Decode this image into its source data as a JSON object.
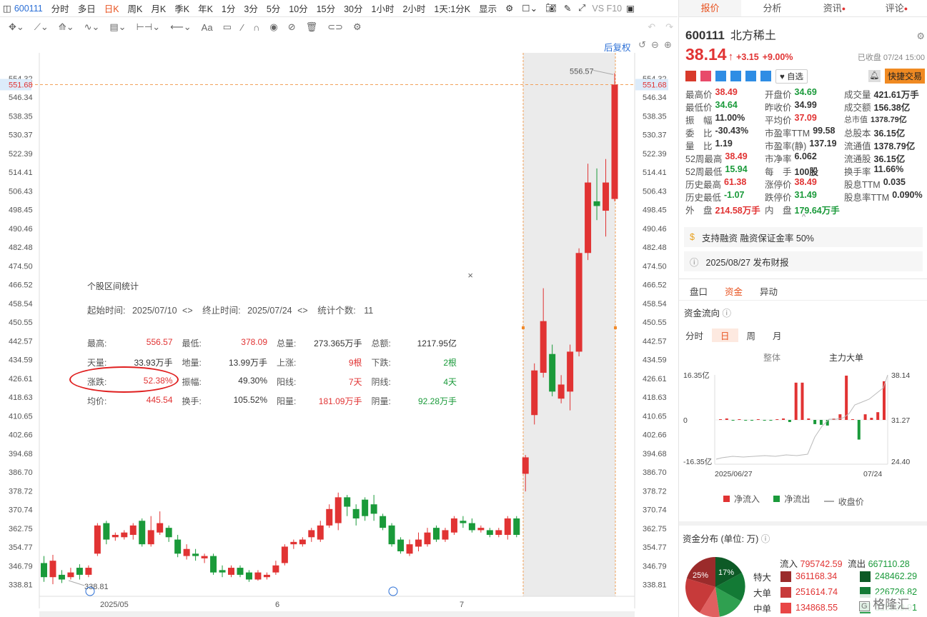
{
  "toolbar": {
    "code": "600111",
    "periods": [
      "分时",
      "多日",
      "日K",
      "周K",
      "月K",
      "季K",
      "年K",
      "1分",
      "3分",
      "5分",
      "10分",
      "15分",
      "30分",
      "1小时",
      "2小时",
      "1天:1分K",
      "显示"
    ],
    "active_period": "日K",
    "vs_label": "VS F10"
  },
  "chart": {
    "fuquan_label": "后复权",
    "y_ticks": [
      "554.32",
      "546.34",
      "538.35",
      "530.37",
      "522.39",
      "514.41",
      "506.43",
      "498.45",
      "490.46",
      "482.48",
      "474.50",
      "466.52",
      "458.54",
      "450.55",
      "442.57",
      "434.59",
      "426.61",
      "418.63",
      "410.65",
      "402.66",
      "394.68",
      "386.70",
      "378.72",
      "370.74",
      "362.75",
      "354.77",
      "346.79",
      "338.81"
    ],
    "x_labels": [
      "2025/05",
      "6",
      "7"
    ],
    "current_price_label": "551.68",
    "high_label": "556.57",
    "low_label": "338.81"
  },
  "chart_data": {
    "type": "candlestick",
    "ylim": [
      334,
      558
    ],
    "candles": [
      {
        "o": 348.0,
        "c": 342.0,
        "h": 351.0,
        "l": 340.0
      },
      {
        "o": 342.0,
        "c": 349.0,
        "h": 351.5,
        "l": 339.0
      },
      {
        "o": 343.0,
        "c": 341.0,
        "h": 345.0,
        "l": 339.5
      },
      {
        "o": 342.0,
        "c": 344.0,
        "h": 346.0,
        "l": 341.0
      },
      {
        "o": 346.0,
        "c": 343.0,
        "h": 347.5,
        "l": 341.0
      },
      {
        "o": 343.0,
        "c": 346.0,
        "h": 347.0,
        "l": 342.0
      },
      {
        "o": 352.0,
        "c": 364.0,
        "h": 365.0,
        "l": 351.0
      },
      {
        "o": 365.0,
        "c": 358.0,
        "h": 366.0,
        "l": 356.0
      },
      {
        "o": 359.0,
        "c": 360.0,
        "h": 361.0,
        "l": 357.5
      },
      {
        "o": 359.0,
        "c": 361.0,
        "h": 362.0,
        "l": 358.0
      },
      {
        "o": 360.0,
        "c": 364.0,
        "h": 365.0,
        "l": 358.0
      },
      {
        "o": 366.0,
        "c": 356.0,
        "h": 367.0,
        "l": 355.0
      },
      {
        "o": 356.0,
        "c": 362.0,
        "h": 368.0,
        "l": 355.0
      },
      {
        "o": 361.0,
        "c": 365.0,
        "h": 370.0,
        "l": 360.0
      },
      {
        "o": 363.0,
        "c": 359.0,
        "h": 364.0,
        "l": 357.0
      },
      {
        "o": 358.0,
        "c": 352.0,
        "h": 360.0,
        "l": 350.5
      },
      {
        "o": 351.0,
        "c": 354.0,
        "h": 356.0,
        "l": 349.5
      },
      {
        "o": 352.0,
        "c": 351.0,
        "h": 354.0,
        "l": 349.0
      },
      {
        "o": 350.0,
        "c": 351.0,
        "h": 352.0,
        "l": 348.0
      },
      {
        "o": 351.0,
        "c": 344.0,
        "h": 352.0,
        "l": 343.0
      },
      {
        "o": 345.0,
        "c": 344.0,
        "h": 347.0,
        "l": 342.0
      },
      {
        "o": 343.0,
        "c": 346.0,
        "h": 347.0,
        "l": 342.0
      },
      {
        "o": 346.0,
        "c": 343.0,
        "h": 347.0,
        "l": 342.0
      },
      {
        "o": 344.0,
        "c": 341.0,
        "h": 345.0,
        "l": 340.0
      },
      {
        "o": 341.0,
        "c": 344.0,
        "h": 345.0,
        "l": 340.5
      },
      {
        "o": 342.0,
        "c": 343.0,
        "h": 344.0,
        "l": 341.0
      },
      {
        "o": 344.0,
        "c": 347.0,
        "h": 349.0,
        "l": 343.0
      },
      {
        "o": 348.0,
        "c": 355.0,
        "h": 356.0,
        "l": 347.0
      },
      {
        "o": 356.0,
        "c": 357.0,
        "h": 358.0,
        "l": 354.0
      },
      {
        "o": 356.0,
        "c": 358.0,
        "h": 359.0,
        "l": 355.0
      },
      {
        "o": 359.0,
        "c": 362.0,
        "h": 363.0,
        "l": 357.0
      },
      {
        "o": 358.0,
        "c": 364.0,
        "h": 366.0,
        "l": 357.0
      },
      {
        "o": 364.0,
        "c": 371.0,
        "h": 373.0,
        "l": 363.0
      },
      {
        "o": 365.0,
        "c": 376.0,
        "h": 378.0,
        "l": 362.0
      },
      {
        "o": 376.0,
        "c": 372.0,
        "h": 377.0,
        "l": 368.0
      },
      {
        "o": 371.0,
        "c": 367.0,
        "h": 373.0,
        "l": 364.0
      },
      {
        "o": 375.0,
        "c": 368.0,
        "h": 376.0,
        "l": 366.0
      },
      {
        "o": 373.0,
        "c": 369.0,
        "h": 377.0,
        "l": 366.0
      },
      {
        "o": 368.0,
        "c": 363.0,
        "h": 369.0,
        "l": 362.0
      },
      {
        "o": 364.0,
        "c": 356.0,
        "h": 365.0,
        "l": 355.0
      },
      {
        "o": 358.0,
        "c": 353.0,
        "h": 359.0,
        "l": 352.0
      },
      {
        "o": 352.0,
        "c": 356.0,
        "h": 358.0,
        "l": 351.0
      },
      {
        "o": 355.0,
        "c": 358.0,
        "h": 361.0,
        "l": 353.0
      },
      {
        "o": 356.0,
        "c": 361.0,
        "h": 363.0,
        "l": 355.0
      },
      {
        "o": 363.0,
        "c": 358.0,
        "h": 364.0,
        "l": 357.0
      },
      {
        "o": 358.0,
        "c": 362.0,
        "h": 363.0,
        "l": 357.0
      },
      {
        "o": 361.0,
        "c": 367.0,
        "h": 368.0,
        "l": 360.0
      },
      {
        "o": 366.0,
        "c": 365.0,
        "h": 368.0,
        "l": 363.0
      },
      {
        "o": 365.0,
        "c": 362.0,
        "h": 367.0,
        "l": 361.0
      },
      {
        "o": 362.0,
        "c": 363.0,
        "h": 364.0,
        "l": 361.0
      },
      {
        "o": 362.0,
        "c": 360.0,
        "h": 363.0,
        "l": 359.0
      },
      {
        "o": 360.0,
        "c": 362.0,
        "h": 363.0,
        "l": 359.0
      },
      {
        "o": 360.0,
        "c": 367.0,
        "h": 368.0,
        "l": 358.0
      },
      {
        "o": 367.0,
        "c": 360.0,
        "h": 368.0,
        "l": 359.0
      },
      {
        "o": 386.0,
        "c": 393.0,
        "h": 394.0,
        "l": 378.5
      },
      {
        "o": 411.0,
        "c": 430.0,
        "h": 433.0,
        "l": 407.0
      },
      {
        "o": 429.0,
        "c": 451.0,
        "h": 465.0,
        "l": 427.0
      },
      {
        "o": 437.0,
        "c": 421.0,
        "h": 441.0,
        "l": 419.0
      },
      {
        "o": 418.0,
        "c": 424.0,
        "h": 428.0,
        "l": 416.0
      },
      {
        "o": 421.0,
        "c": 438.0,
        "h": 441.0,
        "l": 413.0
      },
      {
        "o": 438.0,
        "c": 480.0,
        "h": 482.0,
        "l": 436.0
      },
      {
        "o": 480.0,
        "c": 510.0,
        "h": 518.0,
        "l": 477.0
      },
      {
        "o": 502.0,
        "c": 500.0,
        "h": 516.0,
        "l": 494.0
      },
      {
        "o": 498.0,
        "c": 510.0,
        "h": 520.0,
        "l": 487.0
      },
      {
        "o": 503.0,
        "c": 551.68,
        "h": 556.57,
        "l": 502.0
      }
    ]
  },
  "stats": {
    "title": "个股区间统计",
    "start_label": "起始时间:",
    "start_date": "2025/07/10",
    "end_label": "终止时间:",
    "end_date": "2025/07/24",
    "count_label": "统计个数:",
    "count": "11",
    "rows": [
      [
        [
          "最高:",
          "556.57",
          "red"
        ],
        [
          "最低:",
          "378.09",
          "red"
        ],
        [
          "总量:",
          "273.365万手",
          ""
        ],
        [
          "总额:",
          "1217.95亿",
          ""
        ]
      ],
      [
        [
          "天量:",
          "33.93万手",
          ""
        ],
        [
          "地量:",
          "13.99万手",
          ""
        ],
        [
          "上涨:",
          "9根",
          "red"
        ],
        [
          "下跌:",
          "2根",
          "green"
        ]
      ],
      [
        [
          "涨跌:",
          "52.38%",
          "red"
        ],
        [
          "振幅:",
          "49.30%",
          ""
        ],
        [
          "阳线:",
          "7天",
          "red"
        ],
        [
          "阴线:",
          "4天",
          "green"
        ]
      ],
      [
        [
          "均价:",
          "445.54",
          "red"
        ],
        [
          "换手:",
          "105.52%",
          ""
        ],
        [
          "阳量:",
          "181.09万手",
          "red"
        ],
        [
          "阴量:",
          "92.28万手",
          "green"
        ]
      ]
    ]
  },
  "right": {
    "tabs": [
      "报价",
      "分析",
      "资讯",
      "评论"
    ],
    "code": "600111",
    "name": "北方稀土",
    "price": "38.14",
    "change": "+3.15",
    "change_pct": "+9.00%",
    "status": "已收盘 07/24 15:00",
    "self_select": "自选",
    "quick_trade": "快捷交易",
    "quote": [
      [
        [
          "最高价",
          "38.49",
          "red"
        ],
        [
          "开盘价",
          "34.69",
          "green"
        ],
        [
          "成交量",
          "421.61万手",
          ""
        ]
      ],
      [
        [
          "最低价",
          "34.64",
          "green"
        ],
        [
          "昨收价",
          "34.99",
          ""
        ],
        [
          "成交额",
          "156.38亿",
          ""
        ]
      ],
      [
        [
          "振　幅",
          "11.00%",
          ""
        ],
        [
          "平均价",
          "37.09",
          "red"
        ],
        [
          "总市值",
          "1378.79亿",
          ""
        ]
      ],
      [
        [
          "委　比",
          "-30.43%",
          ""
        ],
        [
          "市盈率TTM",
          "99.58",
          ""
        ],
        [
          "总股本",
          "36.15亿",
          ""
        ]
      ],
      [
        [
          "量　比",
          "1.19",
          ""
        ],
        [
          "市盈率(静)",
          "137.19",
          ""
        ],
        [
          "流通值",
          "1378.79亿",
          ""
        ]
      ],
      [
        [
          "52周最高",
          "38.49",
          "red"
        ],
        [
          "市净率",
          "6.062",
          ""
        ],
        [
          "流通股",
          "36.15亿",
          ""
        ]
      ],
      [
        [
          "52周最低",
          "15.94",
          "green"
        ],
        [
          "每　手",
          "100股",
          ""
        ],
        [
          "换手率",
          "11.66%",
          ""
        ]
      ],
      [
        [
          "历史最高",
          "61.38",
          "red"
        ],
        [
          "涨停价",
          "38.49",
          "red"
        ],
        [
          "股息TTM",
          "0.035",
          ""
        ]
      ],
      [
        [
          "历史最低",
          "-1.07",
          "green"
        ],
        [
          "跌停价",
          "31.49",
          "green"
        ],
        [
          "股息率TTM",
          "0.090%",
          ""
        ]
      ],
      [
        [
          "外　盘",
          "214.58万手",
          "red"
        ],
        [
          "内　盘",
          "179.64万手",
          "green"
        ],
        [
          "",
          "",
          ""
        ]
      ]
    ],
    "margin_info": "支持融资 融资保证金率 50%",
    "report_info": "2025/08/27  发布财报",
    "subtabs": [
      "盘口",
      "资金",
      "异动"
    ],
    "flow_title": "资金流向",
    "flow_periods": [
      "分时",
      "日",
      "周",
      "月"
    ],
    "flow_modes": [
      "整体",
      "主力大单"
    ],
    "flow_left_ticks": [
      "16.35亿",
      "0",
      "-16.35亿"
    ],
    "flow_right_ticks": [
      "38.14",
      "31.27",
      "24.40"
    ],
    "flow_x_labels": [
      "2025/06/27",
      "07/24"
    ],
    "flow_legend": [
      "净流入",
      "净流出",
      "收盘价"
    ],
    "dist_title": "资金分布 (单位: 万)",
    "dist_in_label": "流入",
    "dist_in_total": "795742.59",
    "dist_out_label": "流出",
    "dist_out_total": "667110.28",
    "dist_rows": [
      [
        "特大",
        "361168.34",
        "248462.29"
      ],
      [
        "大单",
        "251614.74",
        "226726.82"
      ],
      [
        "中单",
        "134868.55",
        "125839.91"
      ]
    ],
    "pie_labels": [
      "25%",
      "17%"
    ],
    "watermark": "格隆汇"
  },
  "colors": {
    "up": "#e13333",
    "down": "#1a9a3a",
    "accent": "#e8521f"
  }
}
